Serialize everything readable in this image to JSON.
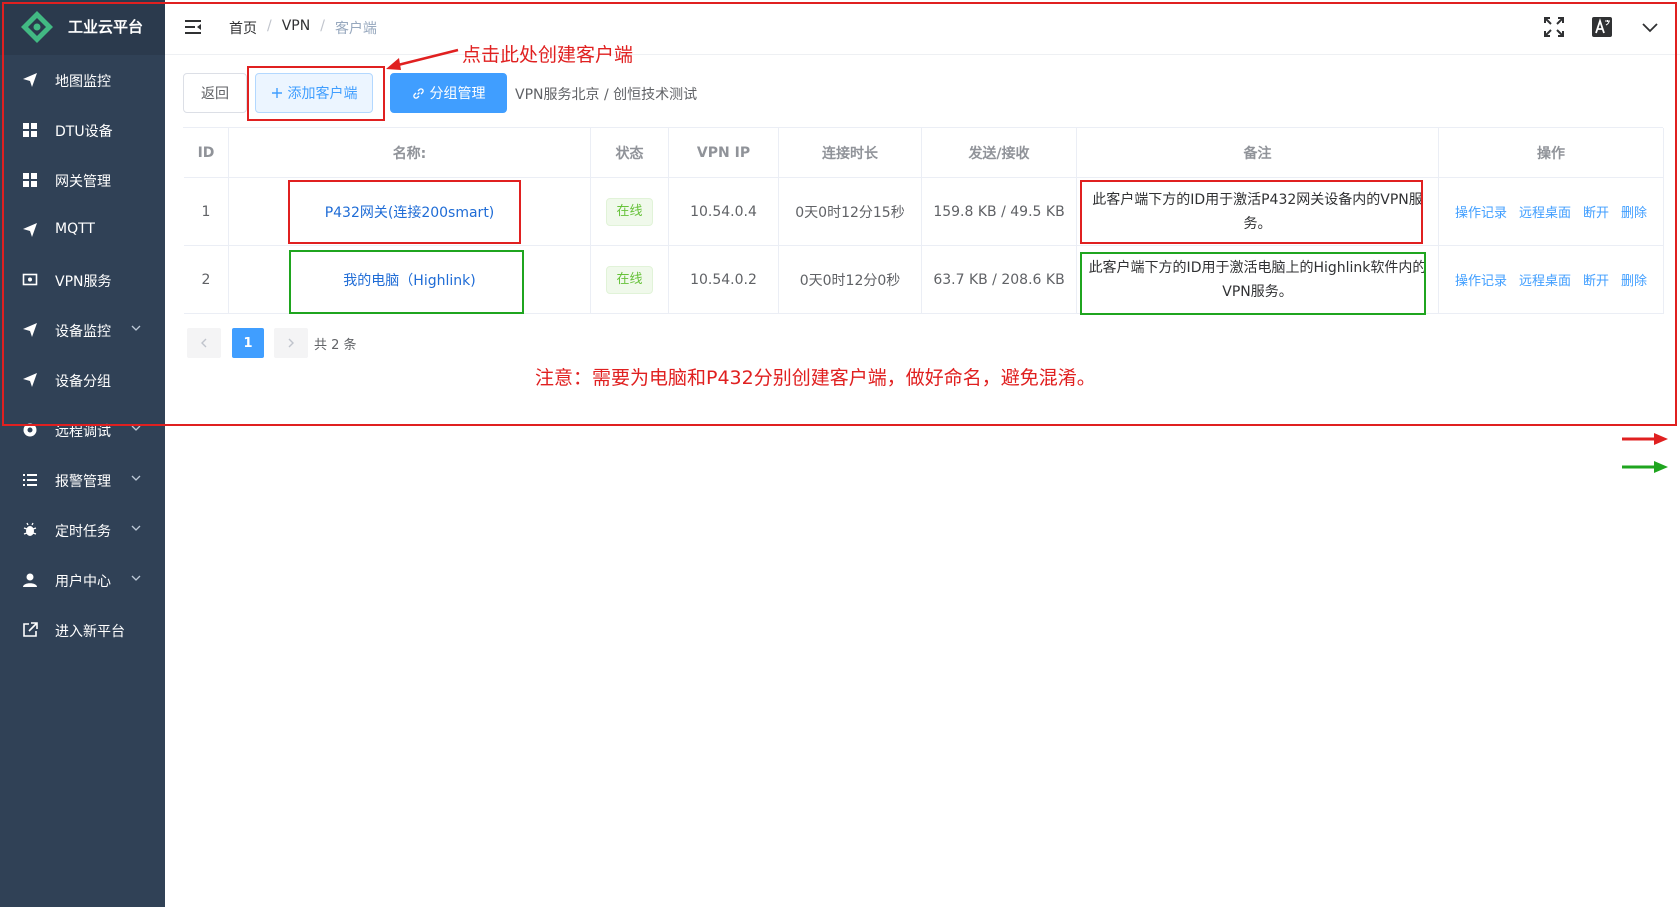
{
  "app": {
    "title": "工业云平台",
    "brand_color": "#42b983",
    "sidebar_color": "#304156"
  },
  "sidebar": {
    "items": [
      {
        "label": "地图监控",
        "icon": "send-icon",
        "has_submenu": false
      },
      {
        "label": "DTU设备",
        "icon": "grid-icon",
        "has_submenu": false
      },
      {
        "label": "网关管理",
        "icon": "grid-icon",
        "has_submenu": false
      },
      {
        "label": "MQTT",
        "icon": "send-icon",
        "has_submenu": false
      },
      {
        "label": "VPN服务",
        "icon": "monitor-icon",
        "has_submenu": false
      },
      {
        "label": "设备监控",
        "icon": "send-icon",
        "has_submenu": true
      },
      {
        "label": "设备分组",
        "icon": "send-icon",
        "has_submenu": false
      },
      {
        "label": "远程调试",
        "icon": "settings-icon",
        "has_submenu": true
      },
      {
        "label": "报警管理",
        "icon": "list-icon",
        "has_submenu": true
      },
      {
        "label": "定时任务",
        "icon": "bug-icon",
        "has_submenu": true
      },
      {
        "label": "用户中心",
        "icon": "user-icon",
        "has_submenu": true
      },
      {
        "label": "进入新平台",
        "icon": "external-link-icon",
        "has_submenu": false
      }
    ]
  },
  "header": {
    "breadcrumb": [
      "首页",
      "VPN",
      "客户端"
    ],
    "separator": "/"
  },
  "toolbar": {
    "back_label": "返回",
    "add_client_label": "添加客户端",
    "group_manage_label": "分组管理",
    "path_text": "VPN服务北京 / 创恒技术测试"
  },
  "table": {
    "headers": {
      "id": "ID",
      "name": "名称:",
      "status": "状态",
      "vpn_ip": "VPN IP",
      "duration": "连接时长",
      "traffic": "发送/接收",
      "note": "备注",
      "ops": "操作"
    },
    "rows": [
      {
        "id": "1",
        "name": "P432网关(连接200smart)",
        "status": "在线",
        "vpn_ip": "10.54.0.4",
        "duration": "0天0时12分15秒",
        "traffic": "159.8 KB / 49.5 KB",
        "note": "此客户端下方的ID用于激活P432网关设备内的VPN服务。"
      },
      {
        "id": "2",
        "name": "我的电脑（Highlink)",
        "status": "在线",
        "vpn_ip": "10.54.0.2",
        "duration": "0天0时12分0秒",
        "traffic": "63.7 KB / 208.6 KB",
        "note": "此客户端下方的ID用于激活电脑上的Highlink软件内的VPN服务。"
      }
    ],
    "ops": [
      "操作记录",
      "远程桌面",
      "断开",
      "删除"
    ]
  },
  "pagination": {
    "current_page": "1",
    "total_text": "共 2 条"
  },
  "annotations": {
    "callout": "点击此处创建客户端",
    "note": "注意：需要为电脑和P432分别创建客户端，做好命名，避免混淆。",
    "red": "#e02020",
    "green": "#1fa51f"
  }
}
